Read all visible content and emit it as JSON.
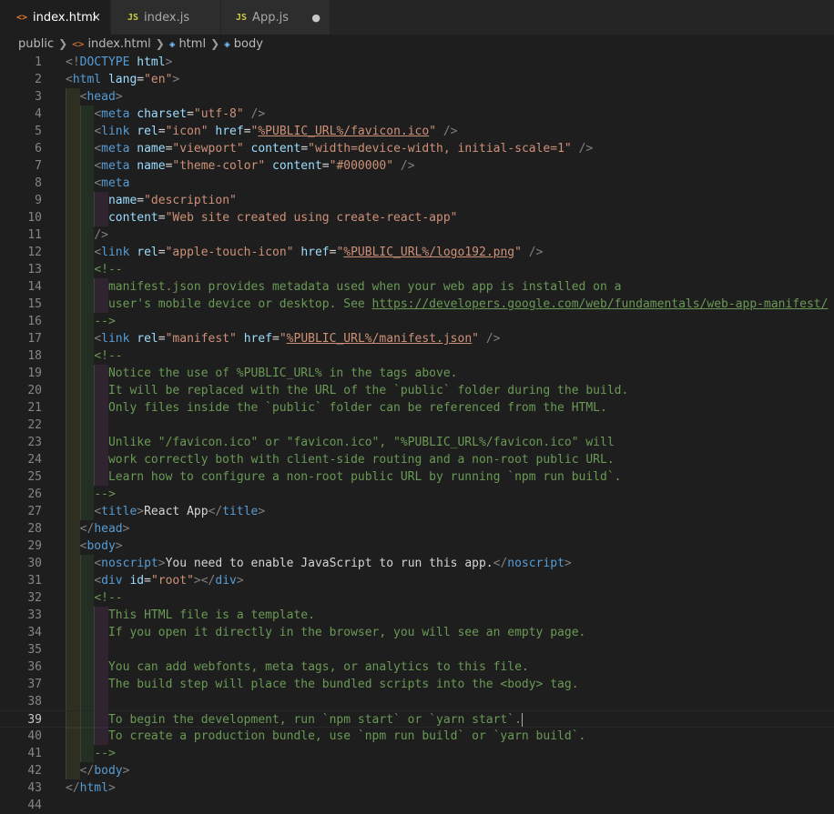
{
  "tabs": [
    {
      "icon": "<>",
      "label": "index.html",
      "active": true,
      "status": "×"
    },
    {
      "icon": "JS",
      "label": "index.js",
      "active": false,
      "status": ""
    },
    {
      "icon": "JS",
      "label": "App.js",
      "active": false,
      "status": "●"
    }
  ],
  "breadcrumb": {
    "folder": "public",
    "file_icon": "<>",
    "file": "index.html",
    "html_icon": "◈",
    "html": "html",
    "body_icon": "◈",
    "body": "body"
  },
  "editor": {
    "current_line": 39,
    "lines": [
      [
        {
          "c": "p",
          "t": "<!"
        },
        {
          "c": "t",
          "t": "DOCTYPE"
        },
        {
          "c": "w",
          "t": " "
        },
        {
          "c": "a",
          "t": "html"
        },
        {
          "c": "p",
          "t": ">"
        }
      ],
      [
        {
          "c": "p",
          "t": "<"
        },
        {
          "c": "t",
          "t": "html"
        },
        {
          "c": "w",
          "t": " "
        },
        {
          "c": "a",
          "t": "lang"
        },
        {
          "c": "w",
          "t": "="
        },
        {
          "c": "s",
          "t": "\"en\""
        },
        {
          "c": "p",
          "t": ">"
        }
      ],
      [
        {
          "c": "w",
          "t": "  "
        },
        {
          "c": "p",
          "t": "<"
        },
        {
          "c": "t",
          "t": "head"
        },
        {
          "c": "p",
          "t": ">"
        }
      ],
      [
        {
          "c": "w",
          "t": "    "
        },
        {
          "c": "p",
          "t": "<"
        },
        {
          "c": "t",
          "t": "meta"
        },
        {
          "c": "w",
          "t": " "
        },
        {
          "c": "a",
          "t": "charset"
        },
        {
          "c": "w",
          "t": "="
        },
        {
          "c": "s",
          "t": "\"utf-8\""
        },
        {
          "c": "w",
          "t": " "
        },
        {
          "c": "p",
          "t": "/>"
        }
      ],
      [
        {
          "c": "w",
          "t": "    "
        },
        {
          "c": "p",
          "t": "<"
        },
        {
          "c": "t",
          "t": "link"
        },
        {
          "c": "w",
          "t": " "
        },
        {
          "c": "a",
          "t": "rel"
        },
        {
          "c": "w",
          "t": "="
        },
        {
          "c": "s",
          "t": "\"icon\""
        },
        {
          "c": "w",
          "t": " "
        },
        {
          "c": "a",
          "t": "href"
        },
        {
          "c": "w",
          "t": "="
        },
        {
          "c": "s",
          "t": "\""
        },
        {
          "c": "su",
          "t": "%PUBLIC_URL%/favicon.ico"
        },
        {
          "c": "s",
          "t": "\""
        },
        {
          "c": "w",
          "t": " "
        },
        {
          "c": "p",
          "t": "/>"
        }
      ],
      [
        {
          "c": "w",
          "t": "    "
        },
        {
          "c": "p",
          "t": "<"
        },
        {
          "c": "t",
          "t": "meta"
        },
        {
          "c": "w",
          "t": " "
        },
        {
          "c": "a",
          "t": "name"
        },
        {
          "c": "w",
          "t": "="
        },
        {
          "c": "s",
          "t": "\"viewport\""
        },
        {
          "c": "w",
          "t": " "
        },
        {
          "c": "a",
          "t": "content"
        },
        {
          "c": "w",
          "t": "="
        },
        {
          "c": "s",
          "t": "\"width=device-width, initial-scale=1\""
        },
        {
          "c": "w",
          "t": " "
        },
        {
          "c": "p",
          "t": "/>"
        }
      ],
      [
        {
          "c": "w",
          "t": "    "
        },
        {
          "c": "p",
          "t": "<"
        },
        {
          "c": "t",
          "t": "meta"
        },
        {
          "c": "w",
          "t": " "
        },
        {
          "c": "a",
          "t": "name"
        },
        {
          "c": "w",
          "t": "="
        },
        {
          "c": "s",
          "t": "\"theme-color\""
        },
        {
          "c": "w",
          "t": " "
        },
        {
          "c": "a",
          "t": "content"
        },
        {
          "c": "w",
          "t": "="
        },
        {
          "c": "s",
          "t": "\"#000000\""
        },
        {
          "c": "w",
          "t": " "
        },
        {
          "c": "p",
          "t": "/>"
        }
      ],
      [
        {
          "c": "w",
          "t": "    "
        },
        {
          "c": "p",
          "t": "<"
        },
        {
          "c": "t",
          "t": "meta"
        }
      ],
      [
        {
          "c": "w",
          "t": "      "
        },
        {
          "c": "a",
          "t": "name"
        },
        {
          "c": "w",
          "t": "="
        },
        {
          "c": "s",
          "t": "\"description\""
        }
      ],
      [
        {
          "c": "w",
          "t": "      "
        },
        {
          "c": "a",
          "t": "content"
        },
        {
          "c": "w",
          "t": "="
        },
        {
          "c": "s",
          "t": "\"Web site created using create-react-app\""
        }
      ],
      [
        {
          "c": "w",
          "t": "    "
        },
        {
          "c": "p",
          "t": "/>"
        }
      ],
      [
        {
          "c": "w",
          "t": "    "
        },
        {
          "c": "p",
          "t": "<"
        },
        {
          "c": "t",
          "t": "link"
        },
        {
          "c": "w",
          "t": " "
        },
        {
          "c": "a",
          "t": "rel"
        },
        {
          "c": "w",
          "t": "="
        },
        {
          "c": "s",
          "t": "\"apple-touch-icon\""
        },
        {
          "c": "w",
          "t": " "
        },
        {
          "c": "a",
          "t": "href"
        },
        {
          "c": "w",
          "t": "="
        },
        {
          "c": "s",
          "t": "\""
        },
        {
          "c": "su",
          "t": "%PUBLIC_URL%/logo192.png"
        },
        {
          "c": "s",
          "t": "\""
        },
        {
          "c": "w",
          "t": " "
        },
        {
          "c": "p",
          "t": "/>"
        }
      ],
      [
        {
          "c": "w",
          "t": "    "
        },
        {
          "c": "c",
          "t": "<!--"
        }
      ],
      [
        {
          "c": "c",
          "t": "      manifest.json provides metadata used when your web app is installed on a"
        }
      ],
      [
        {
          "c": "c",
          "t": "      user's mobile device or desktop. See "
        },
        {
          "c": "cu",
          "t": "https://developers.google.com/web/fundamentals/web-app-manifest/"
        }
      ],
      [
        {
          "c": "w",
          "t": "    "
        },
        {
          "c": "c",
          "t": "-->"
        }
      ],
      [
        {
          "c": "w",
          "t": "    "
        },
        {
          "c": "p",
          "t": "<"
        },
        {
          "c": "t",
          "t": "link"
        },
        {
          "c": "w",
          "t": " "
        },
        {
          "c": "a",
          "t": "rel"
        },
        {
          "c": "w",
          "t": "="
        },
        {
          "c": "s",
          "t": "\"manifest\""
        },
        {
          "c": "w",
          "t": " "
        },
        {
          "c": "a",
          "t": "href"
        },
        {
          "c": "w",
          "t": "="
        },
        {
          "c": "s",
          "t": "\""
        },
        {
          "c": "su",
          "t": "%PUBLIC_URL%/manifest.json"
        },
        {
          "c": "s",
          "t": "\""
        },
        {
          "c": "w",
          "t": " "
        },
        {
          "c": "p",
          "t": "/>"
        }
      ],
      [
        {
          "c": "w",
          "t": "    "
        },
        {
          "c": "c",
          "t": "<!--"
        }
      ],
      [
        {
          "c": "c",
          "t": "      Notice the use of %PUBLIC_URL% in the tags above."
        }
      ],
      [
        {
          "c": "c",
          "t": "      It will be replaced with the URL of the `public` folder during the build."
        }
      ],
      [
        {
          "c": "c",
          "t": "      Only files inside the `public` folder can be referenced from the HTML."
        }
      ],
      [],
      [
        {
          "c": "c",
          "t": "      Unlike \"/favicon.ico\" or \"favicon.ico\", \"%PUBLIC_URL%/favicon.ico\" will"
        }
      ],
      [
        {
          "c": "c",
          "t": "      work correctly both with client-side routing and a non-root public URL."
        }
      ],
      [
        {
          "c": "c",
          "t": "      Learn how to configure a non-root public URL by running `npm run build`."
        }
      ],
      [
        {
          "c": "w",
          "t": "    "
        },
        {
          "c": "c",
          "t": "-->"
        }
      ],
      [
        {
          "c": "w",
          "t": "    "
        },
        {
          "c": "p",
          "t": "<"
        },
        {
          "c": "t",
          "t": "title"
        },
        {
          "c": "p",
          "t": ">"
        },
        {
          "c": "w",
          "t": "React App"
        },
        {
          "c": "p",
          "t": "</"
        },
        {
          "c": "t",
          "t": "title"
        },
        {
          "c": "p",
          "t": ">"
        }
      ],
      [
        {
          "c": "w",
          "t": "  "
        },
        {
          "c": "p",
          "t": "</"
        },
        {
          "c": "t",
          "t": "head"
        },
        {
          "c": "p",
          "t": ">"
        }
      ],
      [
        {
          "c": "w",
          "t": "  "
        },
        {
          "c": "p",
          "t": "<"
        },
        {
          "c": "t",
          "t": "body"
        },
        {
          "c": "p",
          "t": ">"
        }
      ],
      [
        {
          "c": "w",
          "t": "    "
        },
        {
          "c": "p",
          "t": "<"
        },
        {
          "c": "t",
          "t": "noscript"
        },
        {
          "c": "p",
          "t": ">"
        },
        {
          "c": "w",
          "t": "You need to enable JavaScript to run this app."
        },
        {
          "c": "p",
          "t": "</"
        },
        {
          "c": "t",
          "t": "noscript"
        },
        {
          "c": "p",
          "t": ">"
        }
      ],
      [
        {
          "c": "w",
          "t": "    "
        },
        {
          "c": "p",
          "t": "<"
        },
        {
          "c": "t",
          "t": "div"
        },
        {
          "c": "w",
          "t": " "
        },
        {
          "c": "a",
          "t": "id"
        },
        {
          "c": "w",
          "t": "="
        },
        {
          "c": "s",
          "t": "\"root\""
        },
        {
          "c": "p",
          "t": "></"
        },
        {
          "c": "t",
          "t": "div"
        },
        {
          "c": "p",
          "t": ">"
        }
      ],
      [
        {
          "c": "w",
          "t": "    "
        },
        {
          "c": "c",
          "t": "<!--"
        }
      ],
      [
        {
          "c": "c",
          "t": "      This HTML file is a template."
        }
      ],
      [
        {
          "c": "c",
          "t": "      If you open it directly in the browser, you will see an empty page."
        }
      ],
      [],
      [
        {
          "c": "c",
          "t": "      You can add webfonts, meta tags, or analytics to this file."
        }
      ],
      [
        {
          "c": "c",
          "t": "      The build step will place the bundled scripts into the <body> tag."
        }
      ],
      [],
      [
        {
          "c": "c",
          "t": "      To begin the development, run `npm start` or `yarn start`."
        }
      ],
      [
        {
          "c": "c",
          "t": "      To create a production bundle, use `npm run build` or `yarn build`."
        }
      ],
      [
        {
          "c": "w",
          "t": "    "
        },
        {
          "c": "c",
          "t": "-->"
        }
      ],
      [
        {
          "c": "w",
          "t": "  "
        },
        {
          "c": "p",
          "t": "</"
        },
        {
          "c": "t",
          "t": "body"
        },
        {
          "c": "p",
          "t": ">"
        }
      ],
      [
        {
          "c": "p",
          "t": "</"
        },
        {
          "c": "t",
          "t": "html"
        },
        {
          "c": "p",
          "t": ">"
        }
      ],
      []
    ],
    "line_numbers": [
      "1",
      "2",
      "3",
      "4",
      "5",
      "6",
      "7",
      "8",
      "9",
      "10",
      "11",
      "12",
      "13",
      "14",
      "15",
      "16",
      "17",
      "18",
      "19",
      "20",
      "21",
      "22",
      "23",
      "24",
      "25",
      "26",
      "27",
      "28",
      "29",
      "30",
      "31",
      "32",
      "33",
      "34",
      "35",
      "36",
      "37",
      "38",
      "39",
      "40",
      "41",
      "42",
      "43",
      "44"
    ]
  }
}
